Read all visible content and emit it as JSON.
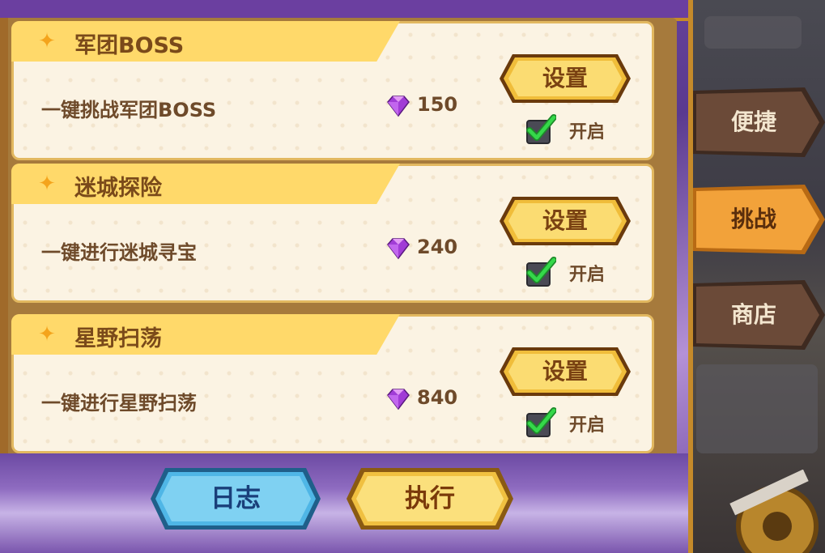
{
  "tasks": [
    {
      "title": "军团BOSS",
      "description": "一键挑战军团BOSS",
      "cost": "150",
      "settings_label": "设置",
      "toggle_label": "开启",
      "enabled": true
    },
    {
      "title": "迷城探险",
      "description": "一键进行迷城寻宝",
      "cost": "240",
      "settings_label": "设置",
      "toggle_label": "开启",
      "enabled": true
    },
    {
      "title": "星野扫荡",
      "description": "一键进行星野扫荡",
      "cost": "840",
      "settings_label": "设置",
      "toggle_label": "开启",
      "enabled": true
    }
  ],
  "side_tabs": [
    {
      "label": "便捷",
      "active": false
    },
    {
      "label": "挑战",
      "active": true
    },
    {
      "label": "商店",
      "active": false
    }
  ],
  "footer": {
    "log_label": "日志",
    "execute_label": "执行"
  },
  "icons": {
    "header": "sparkle-icon",
    "currency": "purple-gem-icon",
    "checkbox": "checkmark-icon"
  },
  "colors": {
    "gold": "#f2c744",
    "purple": "#7d4fb0",
    "blue": "#3d9bd6",
    "active_tab": "#f2a23a",
    "check": "#22c23a"
  }
}
